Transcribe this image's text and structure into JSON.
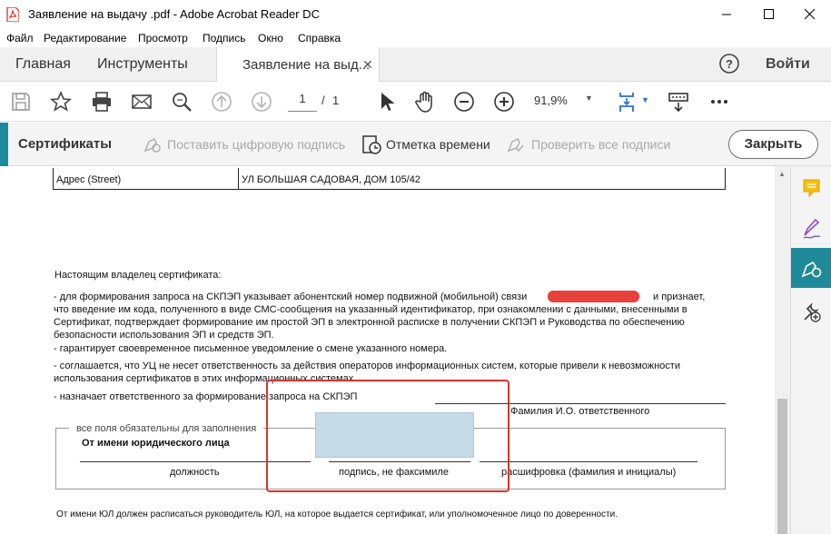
{
  "window": {
    "title": "Заявление на выдачу .pdf - Adobe Acrobat Reader DC"
  },
  "menu": [
    "Файл",
    "Редактирование",
    "Просмотр",
    "Подпись",
    "Окно",
    "Справка"
  ],
  "tabs": {
    "home": "Главная",
    "tools": "Инструменты",
    "document": "Заявление на выд...",
    "signin": "Войти"
  },
  "toolbar": {
    "page_current": "1",
    "page_sep": "/",
    "page_total": "1",
    "zoom": "91,9%"
  },
  "certbar": {
    "title": "Сертификаты",
    "sign": "Поставить цифровую подпись",
    "timestamp": "Отметка времени",
    "verify": "Проверить все подписи",
    "close": "Закрыть"
  },
  "document": {
    "address_label": "Адрес (Street)",
    "address_value": "УЛ БОЛЬШАЯ САДОВАЯ, ДОМ 105/42",
    "intro": "Настоящим владелец сертификата:",
    "p1_a": "- для формирования запроса на СКПЭП указывает абонентский номер подвижной (мобильной) связи",
    "p1_b": "и признает,",
    "p1_line2": "что введение им кода, полученного в виде СМС-сообщения на указанный идентификатор, при ознакомлении с данными, внесенными в",
    "p1_line3": "Сертификат, подтверждает формирование им простой ЭП в электронной расписке в получении СКПЭП и Руководства по обеспечению",
    "p1_line4": "безопасности использования ЭП и средств ЭП.",
    "p2": "- гарантирует своевременное письменное уведомление о смене указанного номера.",
    "p3_line1": " - соглашается, что УЦ не несет ответственность за действия операторов информационных систем, которые привели к невозможности",
    "p3_line2": "использования сертификатов в этих информационных системах.",
    "p4": "- назначает ответственного за формирование запроса на СКПЭП",
    "responsible_caption": "Фамилия И.О. ответственного",
    "required_note": "все поля обязательны для заполнения",
    "legal_entity": "От имени юридического лица",
    "position_caption": "должность",
    "signature_caption": "подпись, не факсимиле",
    "decode_caption": "расшифровка (фамилия и инициалы)",
    "footer": "От имени ЮЛ должен расписаться руководитель ЮЛ, на которое выдается сертификат, или уполномоченное лицо по доверенности."
  },
  "colors": {
    "accent": "#1f8a9a",
    "redaction": "#e8413c",
    "highlight_box": "#d9352e",
    "signature_field": "#c6dbe8"
  }
}
